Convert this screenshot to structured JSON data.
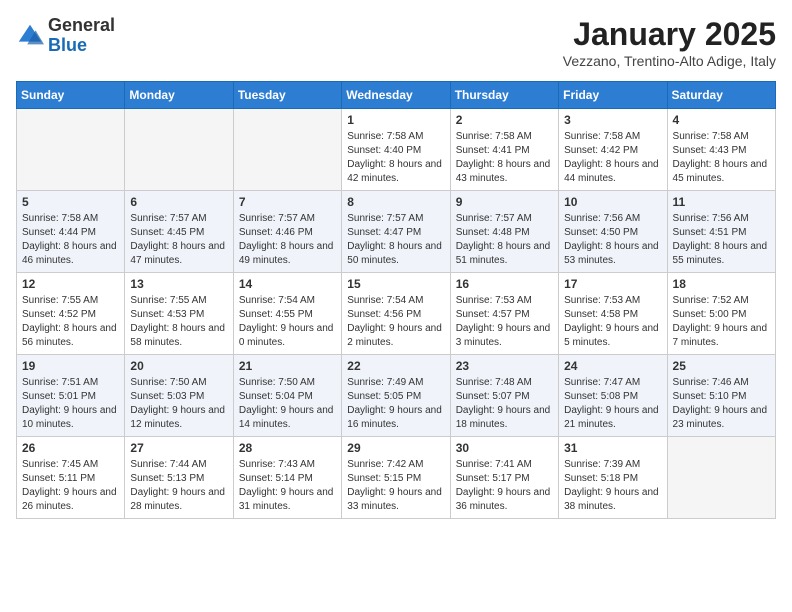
{
  "logo": {
    "general": "General",
    "blue": "Blue"
  },
  "header": {
    "month": "January 2025",
    "location": "Vezzano, Trentino-Alto Adige, Italy"
  },
  "days_of_week": [
    "Sunday",
    "Monday",
    "Tuesday",
    "Wednesday",
    "Thursday",
    "Friday",
    "Saturday"
  ],
  "weeks": [
    [
      {
        "day": "",
        "content": ""
      },
      {
        "day": "",
        "content": ""
      },
      {
        "day": "",
        "content": ""
      },
      {
        "day": "1",
        "content": "Sunrise: 7:58 AM\nSunset: 4:40 PM\nDaylight: 8 hours and 42 minutes."
      },
      {
        "day": "2",
        "content": "Sunrise: 7:58 AM\nSunset: 4:41 PM\nDaylight: 8 hours and 43 minutes."
      },
      {
        "day": "3",
        "content": "Sunrise: 7:58 AM\nSunset: 4:42 PM\nDaylight: 8 hours and 44 minutes."
      },
      {
        "day": "4",
        "content": "Sunrise: 7:58 AM\nSunset: 4:43 PM\nDaylight: 8 hours and 45 minutes."
      }
    ],
    [
      {
        "day": "5",
        "content": "Sunrise: 7:58 AM\nSunset: 4:44 PM\nDaylight: 8 hours and 46 minutes."
      },
      {
        "day": "6",
        "content": "Sunrise: 7:57 AM\nSunset: 4:45 PM\nDaylight: 8 hours and 47 minutes."
      },
      {
        "day": "7",
        "content": "Sunrise: 7:57 AM\nSunset: 4:46 PM\nDaylight: 8 hours and 49 minutes."
      },
      {
        "day": "8",
        "content": "Sunrise: 7:57 AM\nSunset: 4:47 PM\nDaylight: 8 hours and 50 minutes."
      },
      {
        "day": "9",
        "content": "Sunrise: 7:57 AM\nSunset: 4:48 PM\nDaylight: 8 hours and 51 minutes."
      },
      {
        "day": "10",
        "content": "Sunrise: 7:56 AM\nSunset: 4:50 PM\nDaylight: 8 hours and 53 minutes."
      },
      {
        "day": "11",
        "content": "Sunrise: 7:56 AM\nSunset: 4:51 PM\nDaylight: 8 hours and 55 minutes."
      }
    ],
    [
      {
        "day": "12",
        "content": "Sunrise: 7:55 AM\nSunset: 4:52 PM\nDaylight: 8 hours and 56 minutes."
      },
      {
        "day": "13",
        "content": "Sunrise: 7:55 AM\nSunset: 4:53 PM\nDaylight: 8 hours and 58 minutes."
      },
      {
        "day": "14",
        "content": "Sunrise: 7:54 AM\nSunset: 4:55 PM\nDaylight: 9 hours and 0 minutes."
      },
      {
        "day": "15",
        "content": "Sunrise: 7:54 AM\nSunset: 4:56 PM\nDaylight: 9 hours and 2 minutes."
      },
      {
        "day": "16",
        "content": "Sunrise: 7:53 AM\nSunset: 4:57 PM\nDaylight: 9 hours and 3 minutes."
      },
      {
        "day": "17",
        "content": "Sunrise: 7:53 AM\nSunset: 4:58 PM\nDaylight: 9 hours and 5 minutes."
      },
      {
        "day": "18",
        "content": "Sunrise: 7:52 AM\nSunset: 5:00 PM\nDaylight: 9 hours and 7 minutes."
      }
    ],
    [
      {
        "day": "19",
        "content": "Sunrise: 7:51 AM\nSunset: 5:01 PM\nDaylight: 9 hours and 10 minutes."
      },
      {
        "day": "20",
        "content": "Sunrise: 7:50 AM\nSunset: 5:03 PM\nDaylight: 9 hours and 12 minutes."
      },
      {
        "day": "21",
        "content": "Sunrise: 7:50 AM\nSunset: 5:04 PM\nDaylight: 9 hours and 14 minutes."
      },
      {
        "day": "22",
        "content": "Sunrise: 7:49 AM\nSunset: 5:05 PM\nDaylight: 9 hours and 16 minutes."
      },
      {
        "day": "23",
        "content": "Sunrise: 7:48 AM\nSunset: 5:07 PM\nDaylight: 9 hours and 18 minutes."
      },
      {
        "day": "24",
        "content": "Sunrise: 7:47 AM\nSunset: 5:08 PM\nDaylight: 9 hours and 21 minutes."
      },
      {
        "day": "25",
        "content": "Sunrise: 7:46 AM\nSunset: 5:10 PM\nDaylight: 9 hours and 23 minutes."
      }
    ],
    [
      {
        "day": "26",
        "content": "Sunrise: 7:45 AM\nSunset: 5:11 PM\nDaylight: 9 hours and 26 minutes."
      },
      {
        "day": "27",
        "content": "Sunrise: 7:44 AM\nSunset: 5:13 PM\nDaylight: 9 hours and 28 minutes."
      },
      {
        "day": "28",
        "content": "Sunrise: 7:43 AM\nSunset: 5:14 PM\nDaylight: 9 hours and 31 minutes."
      },
      {
        "day": "29",
        "content": "Sunrise: 7:42 AM\nSunset: 5:15 PM\nDaylight: 9 hours and 33 minutes."
      },
      {
        "day": "30",
        "content": "Sunrise: 7:41 AM\nSunset: 5:17 PM\nDaylight: 9 hours and 36 minutes."
      },
      {
        "day": "31",
        "content": "Sunrise: 7:39 AM\nSunset: 5:18 PM\nDaylight: 9 hours and 38 minutes."
      },
      {
        "day": "",
        "content": ""
      }
    ]
  ]
}
